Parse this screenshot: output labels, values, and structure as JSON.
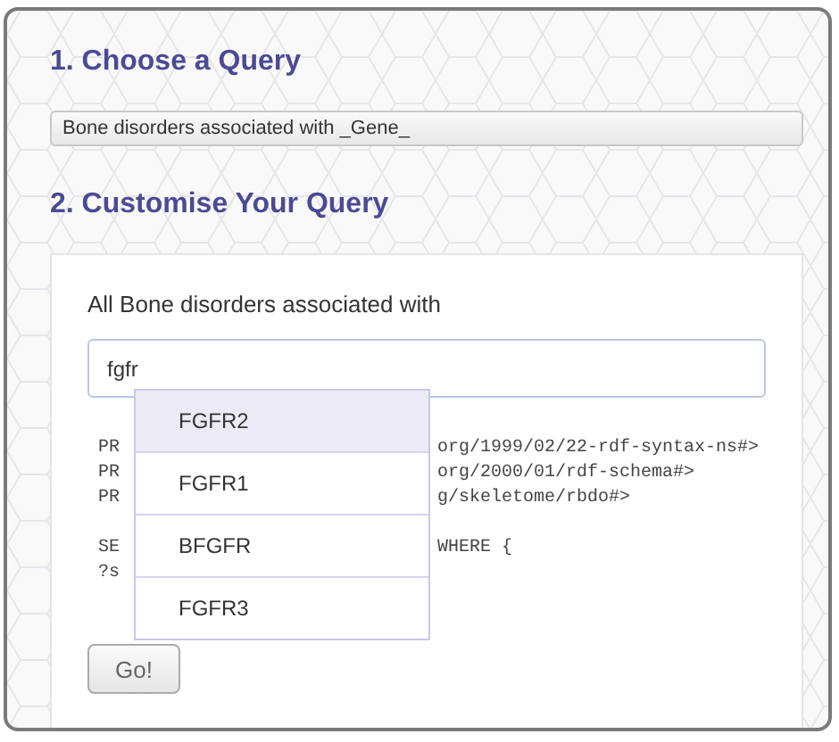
{
  "sections": [
    {
      "number": "1.",
      "title": "Choose a Query"
    },
    {
      "number": "2.",
      "title": "Customise Your Query"
    }
  ],
  "query_select": {
    "value": "Bone disorders associated with _Gene_"
  },
  "customise": {
    "label": "All Bone disorders associated with",
    "input": {
      "value": "fgfr"
    },
    "code_blocks": [
      [
        {
          "left": "PR",
          "right": "org/1999/02/22-rdf-syntax-ns#>"
        },
        {
          "left": "PR",
          "right": "org/2000/01/rdf-schema#>"
        },
        {
          "left": "PR",
          "right": "g/skeletome/rbdo#>"
        }
      ],
      [
        {
          "left": "SE",
          "right": "WHERE {"
        },
        {
          "left": "?s"
        }
      ]
    ],
    "suggestions": [
      {
        "label": "FGFR2",
        "selected": true
      },
      {
        "label": "FGFR1",
        "selected": false
      },
      {
        "label": "BFGFR",
        "selected": false
      },
      {
        "label": "FGFR3",
        "selected": false
      }
    ],
    "button": "Go!"
  }
}
